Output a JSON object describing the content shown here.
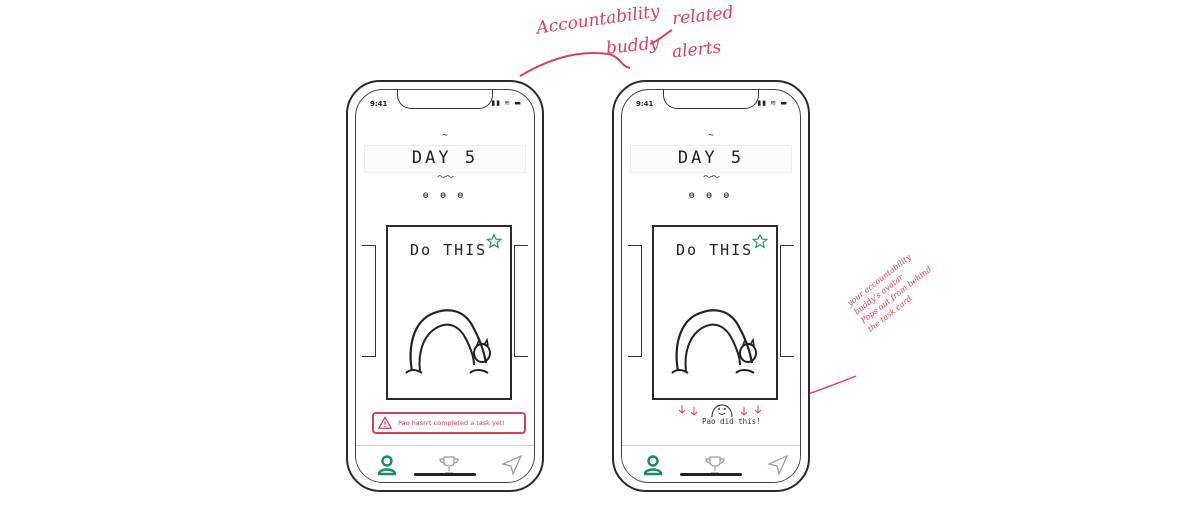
{
  "annotations": {
    "top_line1": "Accountability",
    "top_line2": "buddy",
    "top_side1": "related",
    "top_side2": "alerts",
    "right_lines": [
      "your accountability",
      "buddy's avatar",
      "Pops out from behind",
      "the task card"
    ]
  },
  "phones": [
    {
      "status": {
        "time": "9:41",
        "icons": "▮▮ ≋ ▬"
      },
      "day_title": "DAY 5",
      "squiggle_top": "~",
      "squiggle_bot": "〜〜",
      "dots": "ɵ ɵ ɵ",
      "task_card": {
        "title": "Do THIS"
      },
      "alert": {
        "text": "Pao hasn't completed a task yet!"
      },
      "tabs": [
        "profile-icon",
        "trophy-icon",
        "send-icon"
      ]
    },
    {
      "status": {
        "time": "9:41",
        "icons": "▮▮ ≋ ▬"
      },
      "day_title": "DAY 5",
      "squiggle_top": "~",
      "squiggle_bot": "〜〜",
      "dots": "ɵ ɵ ɵ",
      "task_card": {
        "title": "Do THIS"
      },
      "buddy": {
        "label": "Pao did this!"
      },
      "tabs": [
        "profile-icon",
        "trophy-icon",
        "send-icon"
      ]
    }
  ],
  "colors": {
    "accent": "#d8405f",
    "tab_active": "#1b8a6b",
    "star": "#1b8a6b"
  }
}
